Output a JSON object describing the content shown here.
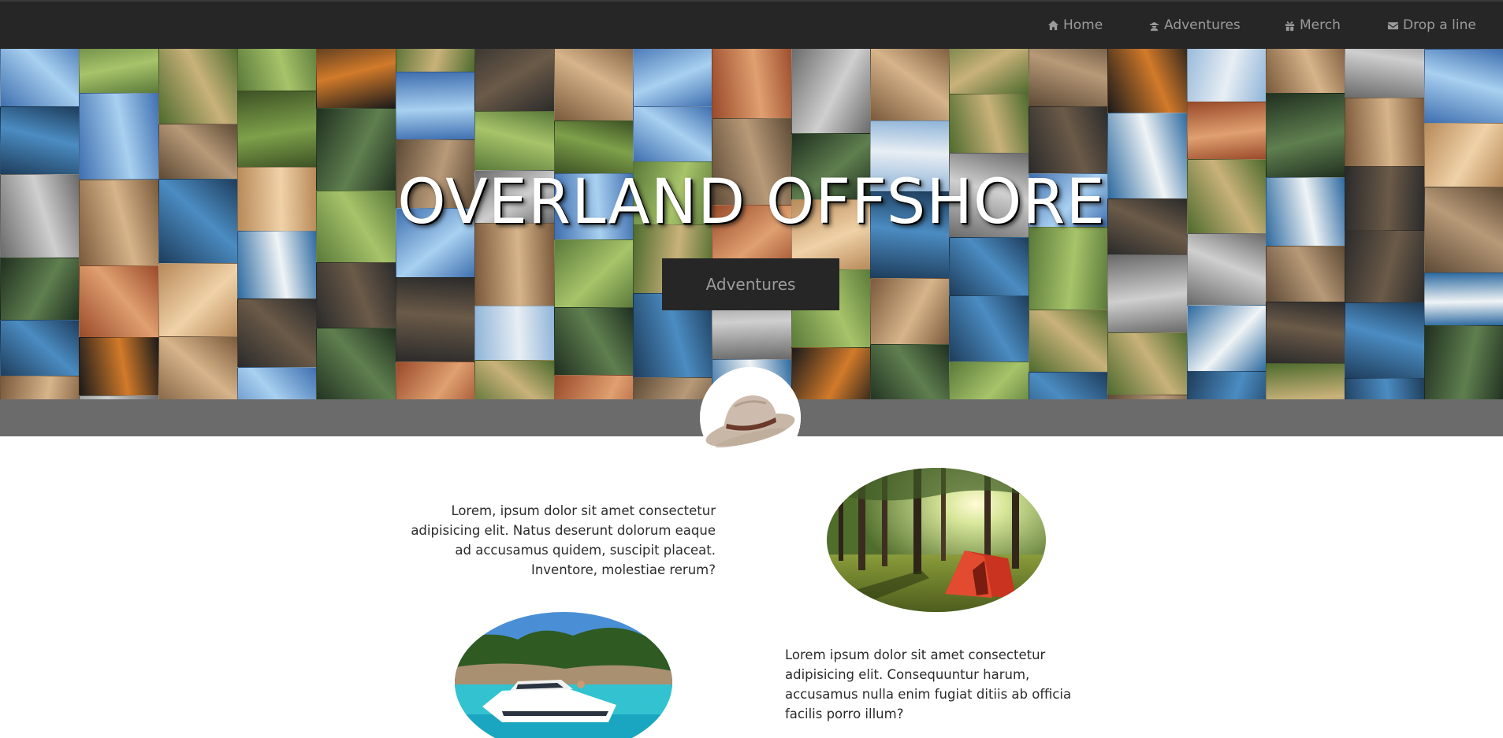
{
  "nav": {
    "items": [
      {
        "label": "Home",
        "icon": "home-icon"
      },
      {
        "label": "Adventures",
        "icon": "adventurer-icon"
      },
      {
        "label": "Merch",
        "icon": "gift-icon"
      },
      {
        "label": "Drop a line",
        "icon": "envelope-icon"
      }
    ]
  },
  "hero": {
    "title": "OVERLAND OFFSHORE",
    "button_label": "Adventures"
  },
  "content": {
    "para_1": "Lorem, ipsum dolor sit amet consectetur adipisicing elit. Natus deserunt dolorum eaque ad accusamus quidem, suscipit placeat. Inventore, molestiae rerum?",
    "para_2": "Lorem ipsum dolor sit amet consectetur adipisicing elit. Consequuntur harum, accusamus nulla enim fugiat ditiis ab officia facilis porro illum?"
  },
  "colors": {
    "nav_bg": "#262626",
    "nav_text": "#9b9b9b",
    "band": "#6b6b6b",
    "hero_text": "#ffffff"
  }
}
